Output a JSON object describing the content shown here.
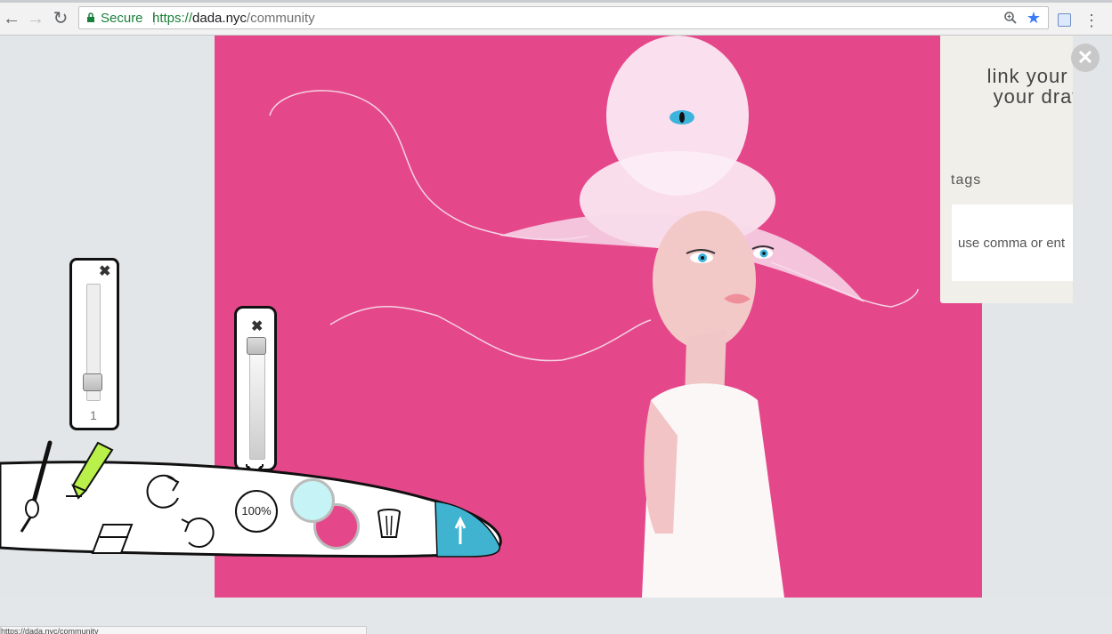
{
  "browser": {
    "secure_label": "Secure",
    "url_protocol": "https://",
    "url_host": "dada.nyc",
    "url_path": "/community"
  },
  "share_panel": {
    "heading": "link your fb a\nyour drawin",
    "tags_label": "tags",
    "tags_placeholder": "use comma or ent"
  },
  "size_popover": {
    "value": "1",
    "slider_level": 0.1
  },
  "opacity_popover": {
    "slider_level": 1.0
  },
  "toolbar": {
    "zoom_label": "100%",
    "primary_color": "#c6f3f5",
    "secondary_color": "#e5488a",
    "send_color": "#3fb3d0"
  },
  "canvas": {
    "background": "#e5488a"
  },
  "status_bar": {
    "text": "https://dada.nyc/community"
  }
}
